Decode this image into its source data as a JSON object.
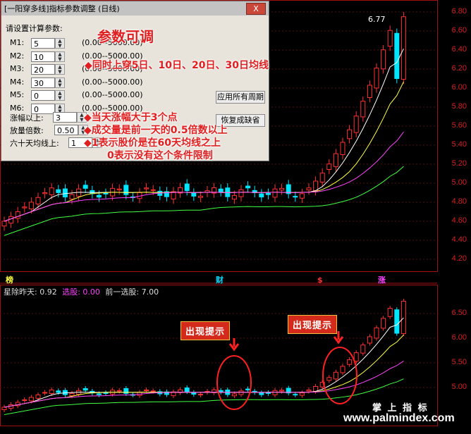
{
  "dialog": {
    "title": "[一阳穿多线]指标参数调整 (日线)",
    "close_label": "X",
    "prompt": "请设置计算参数:",
    "params": [
      {
        "label": "M1:",
        "value": "5",
        "range": "(0.00--5000.00)"
      },
      {
        "label": "M2:",
        "value": "10",
        "range": "(0.00--5000.00)"
      },
      {
        "label": "M3:",
        "value": "20",
        "range": "(0.00--5000.00)"
      },
      {
        "label": "M4:",
        "value": "30",
        "range": "(0.00--5000.00)"
      },
      {
        "label": "M5:",
        "value": "0",
        "range": "(0.00--5000.00)"
      },
      {
        "label": "M6:",
        "value": "0",
        "range": "(0.00--5000.00)"
      }
    ],
    "extra_params": [
      {
        "label": "涨幅以上:",
        "value": "3"
      },
      {
        "label": "放量倍数:",
        "value": "0.50"
      },
      {
        "label": "六十天均线上:",
        "value": "1"
      }
    ],
    "apply_all_label": "应用所有周期",
    "restore_label": "恢复成缺省"
  },
  "annotations": {
    "heading": "参数可调",
    "line1": "◆同时上穿5日、10日、20日、30日均线",
    "line2": "◆当天涨幅大于3个点",
    "line3": "◆成交量是前一天的0.5倍数以上",
    "line4": "◆1表示股价是在60天均线之上",
    "line5": "0表示没有这个条件限制"
  },
  "upper_chart": {
    "price_max_label": "6.77",
    "y_ticks": [
      "6.80",
      "6.60",
      "6.40",
      "6.20",
      "6.00",
      "5.80",
      "5.60",
      "5.40",
      "5.20",
      "5.00",
      "4.80",
      "4.60",
      "4.40",
      "4.20"
    ],
    "markers": {
      "left": "榜",
      "mid": "财",
      "right1": "$",
      "right2": "涨"
    }
  },
  "lower_chart": {
    "legend_a_label": "星除昨天: ",
    "legend_a_value": "0.92",
    "legend_b_label": "选股: ",
    "legend_b_value": "0.00",
    "legend_c_label": "前一选股: ",
    "legend_c_value": "7.00",
    "y_ticks": [
      "6.50",
      "6.00",
      "5.50",
      "5.00"
    ],
    "hint1": "出现提示",
    "hint2": "出现提示"
  },
  "watermark": {
    "line1": "掌 上 指 标",
    "line2": "www.palmindex.com"
  },
  "colors": {
    "up": "#ff3030",
    "down": "#00e5ff",
    "ma5": "#ffffff",
    "ma10": "#ffff40",
    "ma20": "#ff40ff",
    "ma30": "#40ff40",
    "axis": "#a01010"
  }
}
